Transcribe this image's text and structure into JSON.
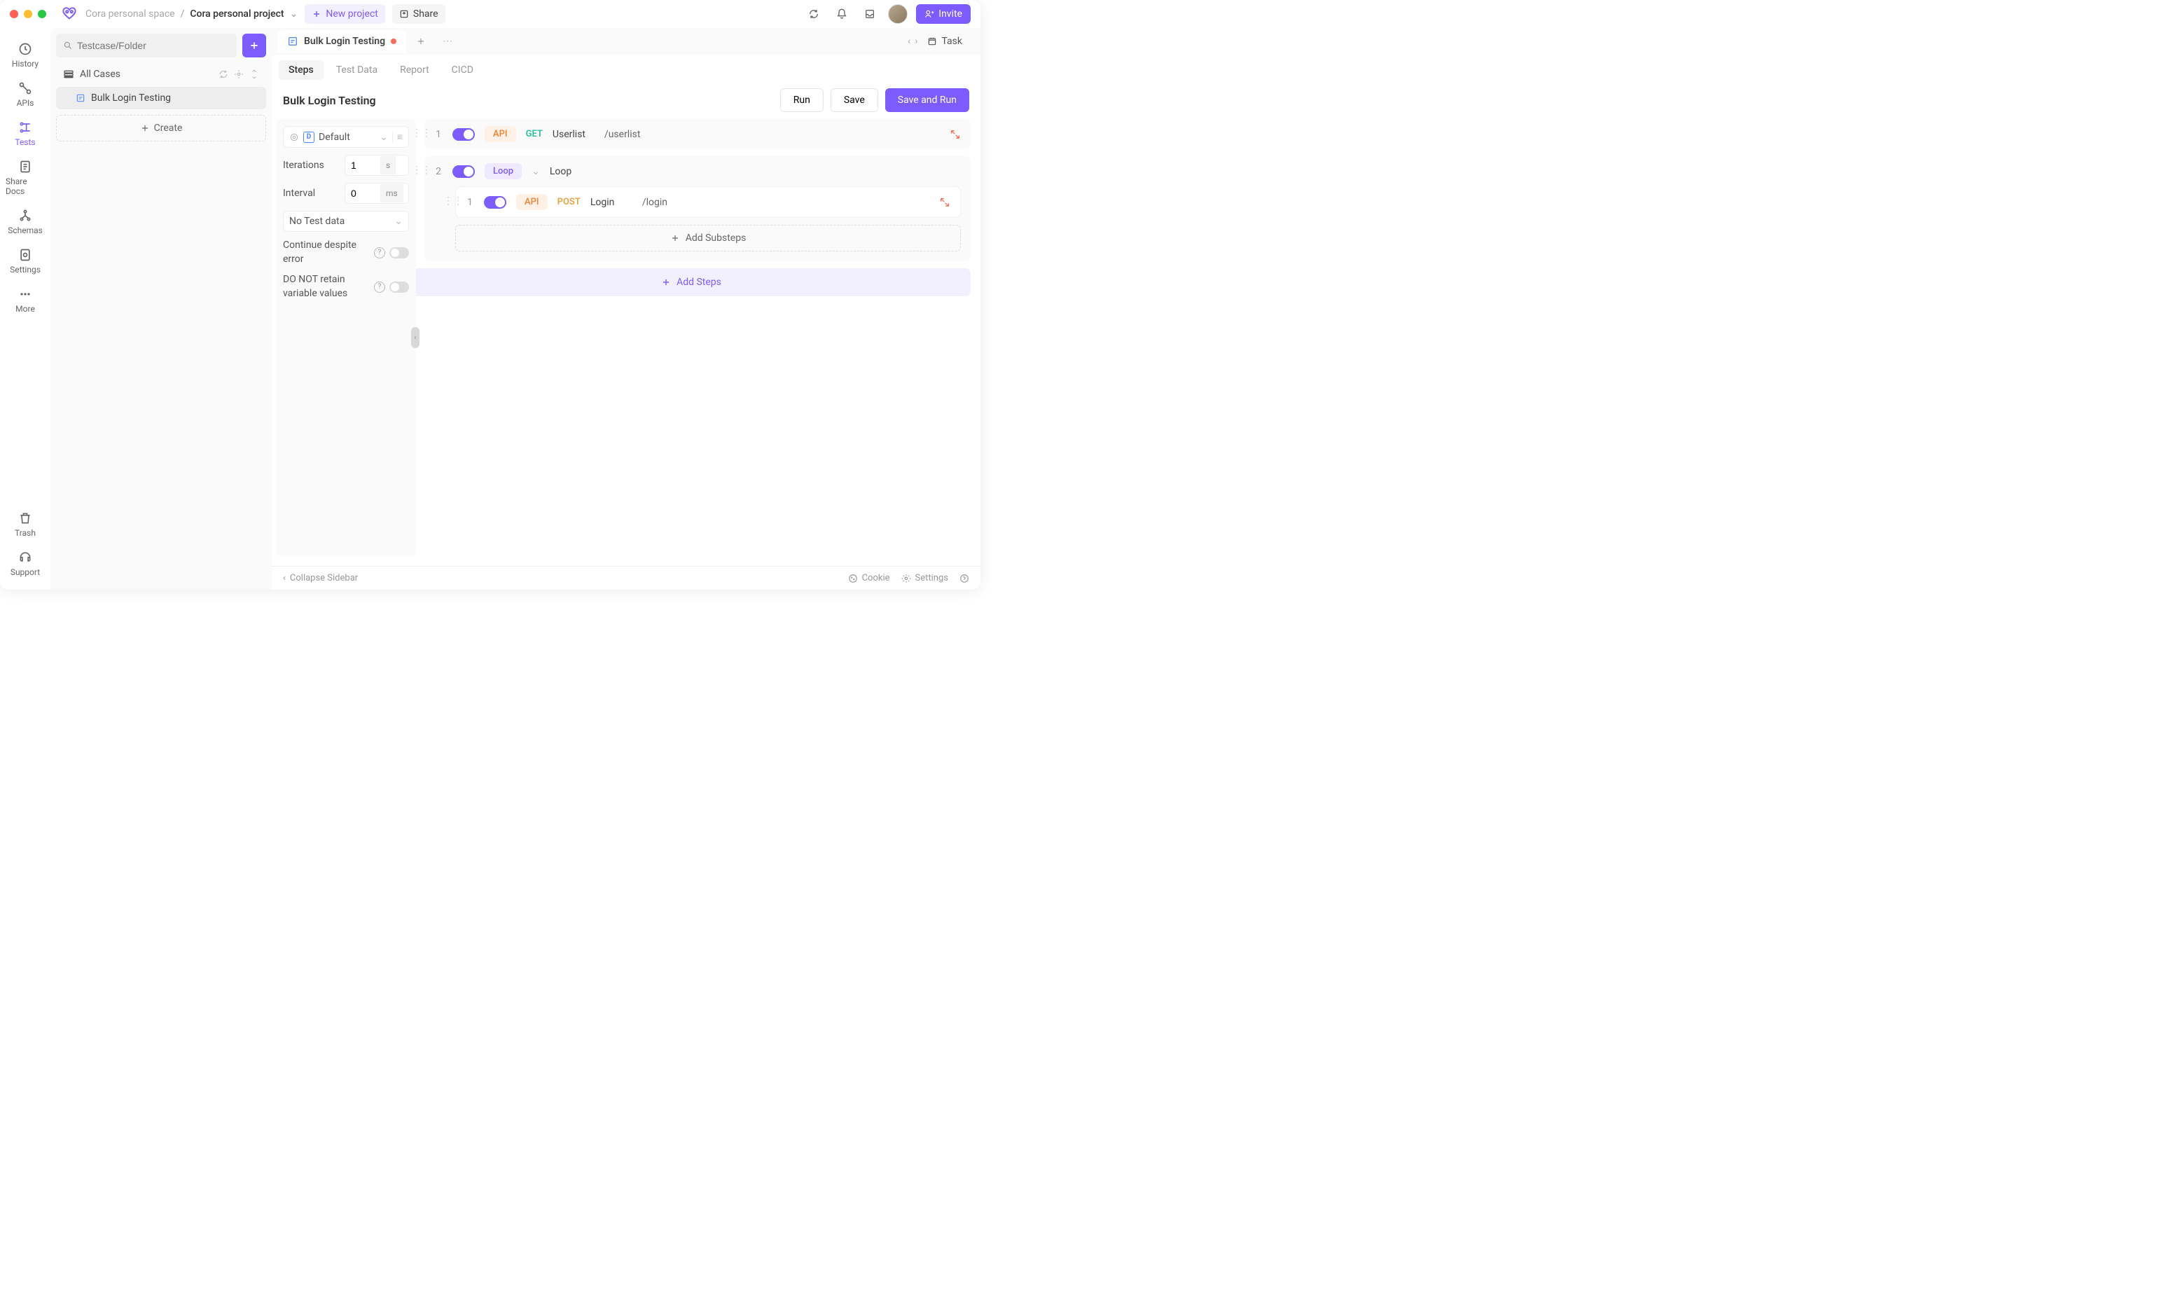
{
  "breadcrumb": {
    "space": "Cora personal space",
    "project": "Cora personal project"
  },
  "topbar": {
    "new_project": "New project",
    "share": "Share",
    "invite": "Invite",
    "task": "Task"
  },
  "leftnav": {
    "history": "History",
    "apis": "APIs",
    "tests": "Tests",
    "sharedocs": "Share Docs",
    "schemas": "Schemas",
    "settings": "Settings",
    "more": "More",
    "trash": "Trash",
    "support": "Support"
  },
  "sidebar": {
    "search_placeholder": "Testcase/Folder",
    "all_cases": "All Cases",
    "case1": "Bulk Login Testing",
    "create": "Create"
  },
  "tab": {
    "title": "Bulk Login Testing"
  },
  "subtabs": {
    "steps": "Steps",
    "testdata": "Test Data",
    "report": "Report",
    "cicd": "CICD"
  },
  "header": {
    "title": "Bulk Login Testing",
    "run": "Run",
    "save": "Save",
    "save_run": "Save and Run"
  },
  "config": {
    "default": "Default",
    "iterations_label": "Iterations",
    "iterations_value": "1",
    "iterations_unit": "s",
    "interval_label": "Interval",
    "interval_value": "0",
    "interval_unit": "ms",
    "testdata": "No Test data",
    "continue_error": "Continue despite error",
    "retain": "DO NOT retain variable values"
  },
  "steps": {
    "s1": {
      "num": "1",
      "tag": "API",
      "method": "GET",
      "name": "Userlist",
      "path": "/userlist"
    },
    "s2": {
      "num": "2",
      "tag": "Loop",
      "name": "Loop"
    },
    "s2_1": {
      "num": "1",
      "tag": "API",
      "method": "POST",
      "name": "Login",
      "path": "/login"
    },
    "add_sub": "Add Substeps",
    "add_steps": "Add Steps"
  },
  "footer": {
    "collapse": "Collapse Sidebar",
    "cookie": "Cookie",
    "settings": "Settings"
  }
}
